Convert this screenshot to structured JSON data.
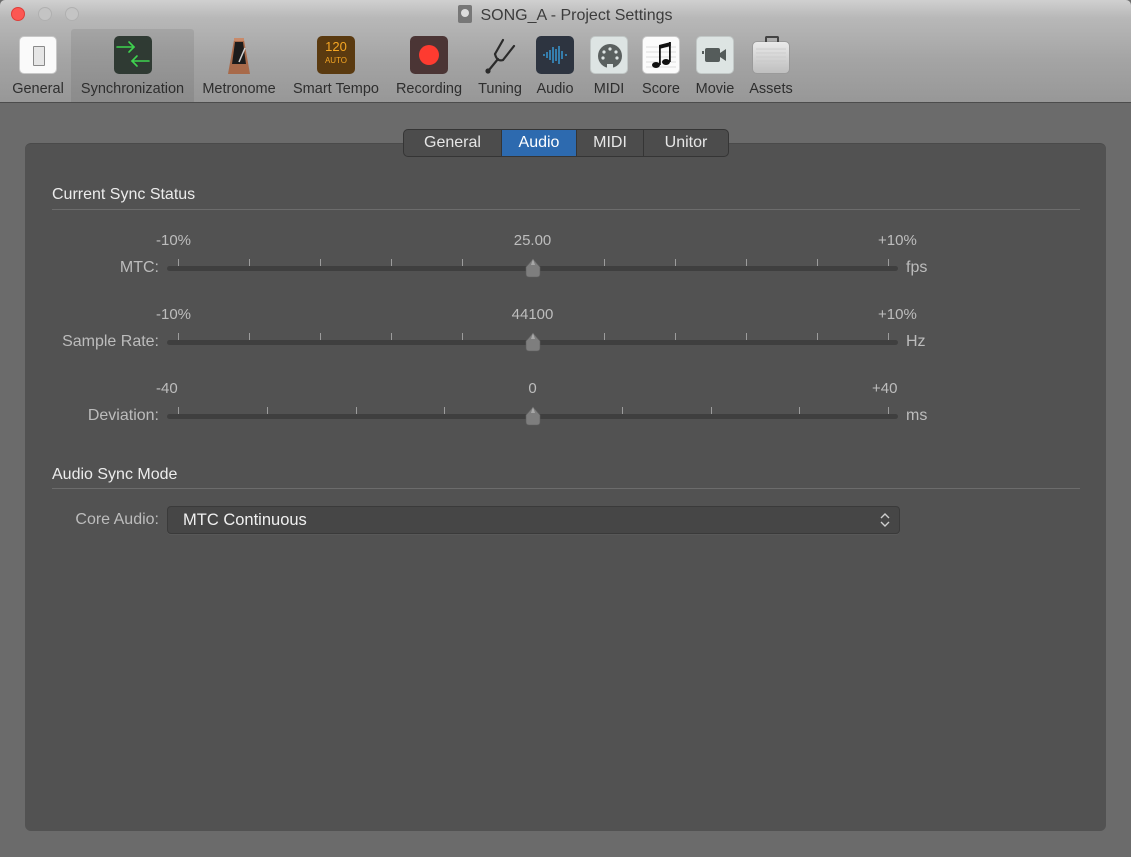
{
  "window": {
    "title": "SONG_A - Project Settings"
  },
  "toolbar": {
    "items": [
      {
        "label": "General",
        "icon": "general-switch-icon",
        "selected": false
      },
      {
        "label": "Synchronization",
        "icon": "sync-arrows-icon",
        "selected": true
      },
      {
        "label": "Metronome",
        "icon": "metronome-icon",
        "selected": false
      },
      {
        "label": "Smart Tempo",
        "icon": "smart-tempo-icon",
        "selected": false,
        "icon_text": "120",
        "icon_subtext": "AUTO"
      },
      {
        "label": "Recording",
        "icon": "record-icon",
        "selected": false
      },
      {
        "label": "Tuning",
        "icon": "tuning-fork-icon",
        "selected": false
      },
      {
        "label": "Audio",
        "icon": "audio-waveform-icon",
        "selected": false
      },
      {
        "label": "MIDI",
        "icon": "midi-connector-icon",
        "selected": false
      },
      {
        "label": "Score",
        "icon": "score-note-icon",
        "selected": false
      },
      {
        "label": "Movie",
        "icon": "movie-camera-icon",
        "selected": false
      },
      {
        "label": "Assets",
        "icon": "assets-briefcase-icon",
        "selected": false
      }
    ]
  },
  "tabs": {
    "items": [
      {
        "label": "General",
        "active": false
      },
      {
        "label": "Audio",
        "active": true
      },
      {
        "label": "MIDI",
        "active": false
      },
      {
        "label": "Unitor",
        "active": false
      }
    ]
  },
  "sync_status": {
    "title": "Current Sync Status",
    "rows": [
      {
        "label": "MTC:",
        "min_label": "-10%",
        "value_label": "25.00",
        "max_label": "+10%",
        "unit": "fps",
        "position": 0.5,
        "ticks": 11
      },
      {
        "label": "Sample Rate:",
        "min_label": "-10%",
        "value_label": "44100",
        "max_label": "+10%",
        "unit": "Hz",
        "position": 0.5,
        "ticks": 11
      },
      {
        "label": "Deviation:",
        "min_label": "-40",
        "value_label": "0",
        "max_label": "+40",
        "unit": "ms",
        "position": 0.5,
        "ticks": 9
      }
    ]
  },
  "audio_sync_mode": {
    "title": "Audio Sync Mode",
    "core_audio_label": "Core Audio:",
    "core_audio_value": "MTC Continuous"
  },
  "colors": {
    "accent": "#2d6aaf",
    "close_button": "#fc5753",
    "record": "#fe3b30"
  }
}
